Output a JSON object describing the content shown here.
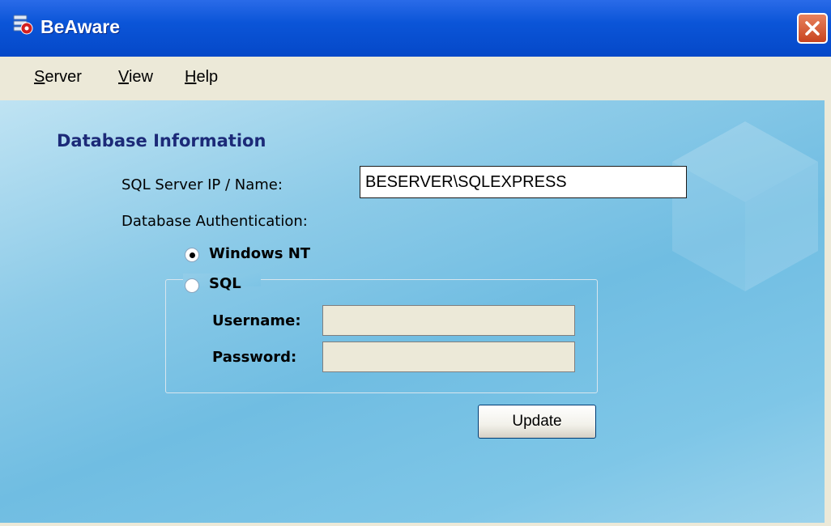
{
  "window": {
    "title": "BeAware",
    "icons": {
      "app": "app-database-icon",
      "close": "close-icon"
    }
  },
  "menu": {
    "items": [
      {
        "label": "Server",
        "mnemonic": "S"
      },
      {
        "label": "View",
        "mnemonic": "V"
      },
      {
        "label": "Help",
        "mnemonic": "H"
      }
    ]
  },
  "form": {
    "section_title": "Database Information",
    "server_label": "SQL Server IP / Name:",
    "server_value": "BESERVER\\SQLEXPRESS",
    "auth_label": "Database Authentication:",
    "auth_options": [
      {
        "label": "Windows NT",
        "selected": true
      },
      {
        "label": "SQL",
        "selected": false
      }
    ],
    "username_label": "Username:",
    "username_value": "",
    "password_label": "Password:",
    "password_value": "",
    "update_label": "Update"
  },
  "colors": {
    "titlebar": "#0b55d8",
    "menubar": "#ece9d8",
    "section_title": "#1c2a78",
    "client_bg": "#7ec6e7"
  }
}
